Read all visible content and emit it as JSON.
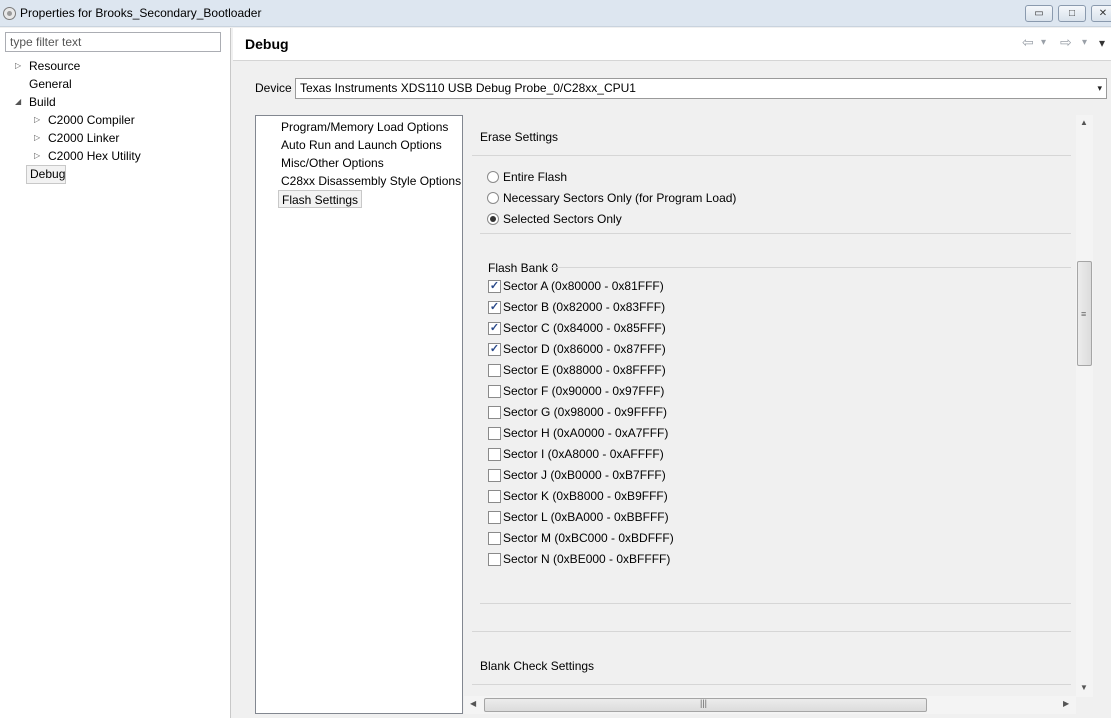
{
  "window": {
    "title": "Properties for Brooks_Secondary_Bootloader",
    "controls": {
      "minimize": "▭",
      "maximize": "□",
      "close": "✕"
    }
  },
  "left_pane": {
    "filter_placeholder": "type filter text",
    "tree": [
      {
        "label": "Resource",
        "expander": "▷"
      },
      {
        "label": "General",
        "expander": ""
      },
      {
        "label": "Build",
        "expander": "◢"
      },
      {
        "label": "C2000 Compiler",
        "expander": "▷"
      },
      {
        "label": "C2000 Linker",
        "expander": "▷"
      },
      {
        "label": "C2000 Hex Utility",
        "expander": "▷"
      },
      {
        "label": "Debug",
        "expander": "",
        "selected": true
      }
    ]
  },
  "header": {
    "title": "Debug",
    "nav_icons": [
      "back-arrow-icon",
      "forward-arrow-icon",
      "view-menu-icon"
    ],
    "glyphs": {
      "back": "⇦",
      "forward": "⇨",
      "dropdown": "▾"
    }
  },
  "device": {
    "label": "Device",
    "value": "Texas Instruments XDS110 USB Debug Probe_0/C28xx_CPU1",
    "arrow": "▾"
  },
  "categories": [
    {
      "label": "Program/Memory Load Options"
    },
    {
      "label": "Auto Run and Launch Options"
    },
    {
      "label": "Misc/Other Options"
    },
    {
      "label": "C28xx Disassembly Style Options"
    },
    {
      "label": "Flash Settings",
      "selected": true
    }
  ],
  "erase_settings": {
    "title": "Erase Settings",
    "options": [
      {
        "label": "Entire Flash",
        "selected": false
      },
      {
        "label": "Necessary Sectors Only (for Program Load)",
        "selected": false
      },
      {
        "label": "Selected Sectors Only",
        "selected": true
      }
    ]
  },
  "flash_bank": {
    "title": "Flash Bank 0",
    "check_glyph": "✓",
    "sectors": [
      {
        "label": "Sector A (0x80000 - 0x81FFF)",
        "checked": true
      },
      {
        "label": "Sector B (0x82000 - 0x83FFF)",
        "checked": true
      },
      {
        "label": "Sector C (0x84000 - 0x85FFF)",
        "checked": true
      },
      {
        "label": "Sector D (0x86000 - 0x87FFF)",
        "checked": true
      },
      {
        "label": "Sector E (0x88000 - 0x8FFFF)",
        "checked": false
      },
      {
        "label": "Sector F (0x90000 - 0x97FFF)",
        "checked": false
      },
      {
        "label": "Sector G (0x98000 - 0x9FFFF)",
        "checked": false
      },
      {
        "label": "Sector H (0xA0000 - 0xA7FFF)",
        "checked": false
      },
      {
        "label": "Sector I (0xA8000 - 0xAFFFF)",
        "checked": false
      },
      {
        "label": "Sector J (0xB0000 - 0xB7FFF)",
        "checked": false
      },
      {
        "label": "Sector K (0xB8000 - 0xB9FFF)",
        "checked": false
      },
      {
        "label": "Sector L (0xBA000 - 0xBBFFF)",
        "checked": false
      },
      {
        "label": "Sector M (0xBC000 - 0xBDFFF)",
        "checked": false
      },
      {
        "label": "Sector N (0xBE000 - 0xBFFFF)",
        "checked": false
      }
    ]
  },
  "blank_check": {
    "title": "Blank Check Settings"
  },
  "scroll_glyphs": {
    "up": "▲",
    "down": "▼",
    "left": "◀",
    "right": "▶",
    "vgrip": "≡",
    "hgrip": "|||"
  }
}
